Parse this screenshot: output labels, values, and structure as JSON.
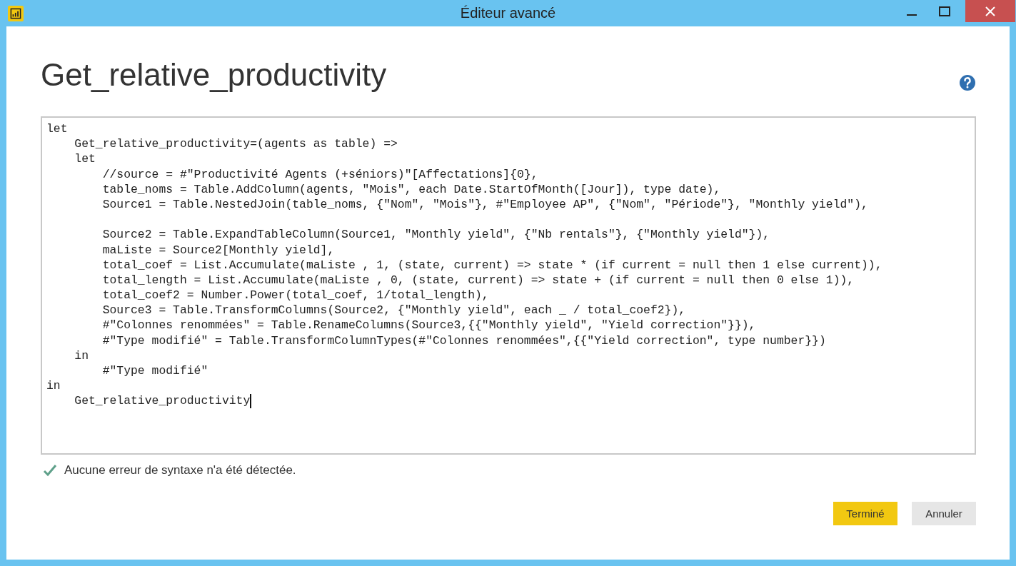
{
  "window": {
    "title": "Éditeur avancé"
  },
  "query_name": "Get_relative_productivity",
  "code_lines": [
    {
      "kind": "code",
      "text": "let"
    },
    {
      "kind": "code",
      "text": "    Get_relative_productivity=(agents as table) =>"
    },
    {
      "kind": "code",
      "text": "    let"
    },
    {
      "kind": "code",
      "text": "        //source = #\"Productivité Agents (+séniors)\"[Affectations]{0},"
    },
    {
      "kind": "code",
      "text": "        table_noms = Table.AddColumn(agents, \"Mois\", each Date.StartOfMonth([Jour]), type date),"
    },
    {
      "kind": "code",
      "text": "        Source1 = Table.NestedJoin(table_noms, {\"Nom\", \"Mois\"}, #\"Employee AP\", {\"Nom\", \"Période\"}, \"Monthly yield\"),"
    },
    {
      "kind": "blank"
    },
    {
      "kind": "code",
      "text": "        Source2 = Table.ExpandTableColumn(Source1, \"Monthly yield\", {\"Nb rentals\"}, {\"Monthly yield\"}),"
    },
    {
      "kind": "code",
      "text": "        maListe = Source2[Monthly yield],"
    },
    {
      "kind": "code",
      "text": "        total_coef = List.Accumulate(maListe , 1, (state, current) => state * (if current = null then 1 else current)),"
    },
    {
      "kind": "code",
      "text": "        total_length = List.Accumulate(maListe , 0, (state, current) => state + (if current = null then 0 else 1)),"
    },
    {
      "kind": "code",
      "text": "        total_coef2 = Number.Power(total_coef, 1/total_length),"
    },
    {
      "kind": "code",
      "text": "        Source3 = Table.TransformColumns(Source2, {\"Monthly yield\", each _ / total_coef2}),"
    },
    {
      "kind": "code",
      "text": "        #\"Colonnes renommées\" = Table.RenameColumns(Source3,{{\"Monthly yield\", \"Yield correction\"}}),"
    },
    {
      "kind": "code",
      "text": "        #\"Type modifié\" = Table.TransformColumnTypes(#\"Colonnes renommées\",{{\"Yield correction\", type number}})"
    },
    {
      "kind": "code",
      "text": "    in"
    },
    {
      "kind": "code",
      "text": "        #\"Type modifié\""
    },
    {
      "kind": "code",
      "text": "in"
    },
    {
      "kind": "code",
      "text": "    Get_relative_productivity",
      "caret": true
    }
  ],
  "status": {
    "ok": true,
    "message": "Aucune erreur de syntaxe n'a été détectée."
  },
  "buttons": [
    {
      "label": "Terminé",
      "kind": "primary"
    },
    {
      "label": "Annuler",
      "kind": "secondary"
    }
  ]
}
